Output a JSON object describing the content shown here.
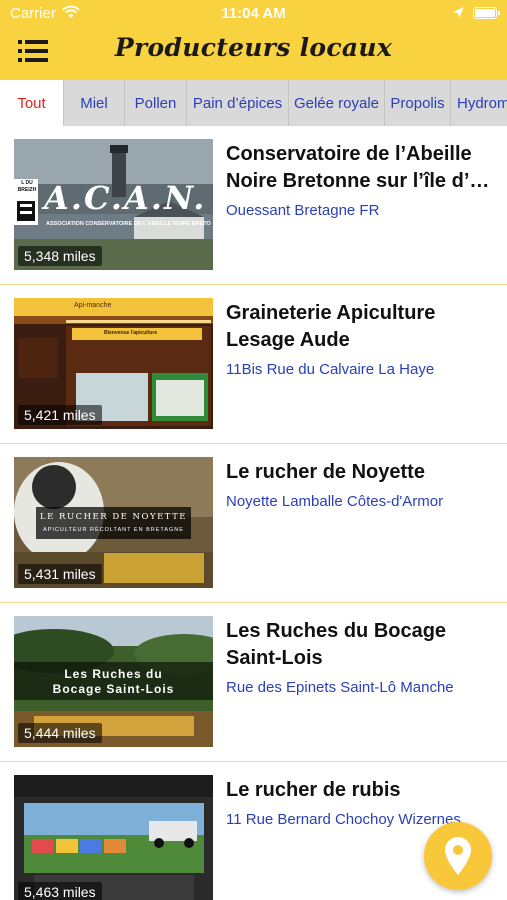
{
  "status_bar": {
    "carrier": "Carrier",
    "time": "11:04 AM"
  },
  "nav": {
    "title": "Producteurs locaux",
    "menu_icon": "hamburger-menu-icon"
  },
  "tabs": [
    {
      "label": "Tout",
      "active": true
    },
    {
      "label": "Miel",
      "active": false
    },
    {
      "label": "Pollen",
      "active": false
    },
    {
      "label": "Pain d’épices",
      "active": false
    },
    {
      "label": "Gelée royale",
      "active": false
    },
    {
      "label": "Propolis",
      "active": false
    },
    {
      "label": "Hydrom",
      "active": false
    }
  ],
  "producers": [
    {
      "title_line1": "Conservatoire de l’Abeille",
      "title_line2": "Noire Bretonne sur l’île d’…",
      "address": "Ouessant Bretagne FR",
      "distance": "5,348 miles",
      "thumb_text": "A.C.A.N.",
      "thumb_subtext": "ASSOCIATION CONSERVATOIRE DE L'ABEILLE NOIRE BRETO",
      "thumb_badge": "L DU BREIZH"
    },
    {
      "title_line1": "Graineterie Apiculture",
      "title_line2": "Lesage Aude",
      "address": "11Bis Rue du Calvaire La Haye",
      "distance": "5,421 miles",
      "thumb_text": "Api-manche",
      "thumb_subtext": "Bienvenue l'apiculture"
    },
    {
      "title_line1": "Le rucher de Noyette",
      "title_line2": "",
      "address": "Noyette Lamballe Côtes-d'Armor",
      "distance": "5,431 miles",
      "thumb_text": "LE RUCHER DE NOYETTE",
      "thumb_subtext": "APICULTEUR RÉCOLTANT EN BRETAGNE"
    },
    {
      "title_line1": "Les Ruches du Bocage",
      "title_line2": "Saint-Lois",
      "address": "Rue des Epinets Saint-Lô Manche",
      "distance": "5,444 miles",
      "thumb_text": "Les Ruches du",
      "thumb_subtext": "Bocage Saint-Lois"
    },
    {
      "title_line1": "Le rucher de rubis",
      "title_line2": "",
      "address": "11 Rue Bernard Chochoy Wizernes",
      "distance": "5,463 miles"
    }
  ],
  "colors": {
    "header": "#f9d23f",
    "tab_bg": "#d9d9d9",
    "active_tab_text": "#e02424",
    "link_text": "#2a3fb8",
    "fab": "#f9c73a"
  },
  "fab": {
    "icon": "map-pin-icon"
  }
}
